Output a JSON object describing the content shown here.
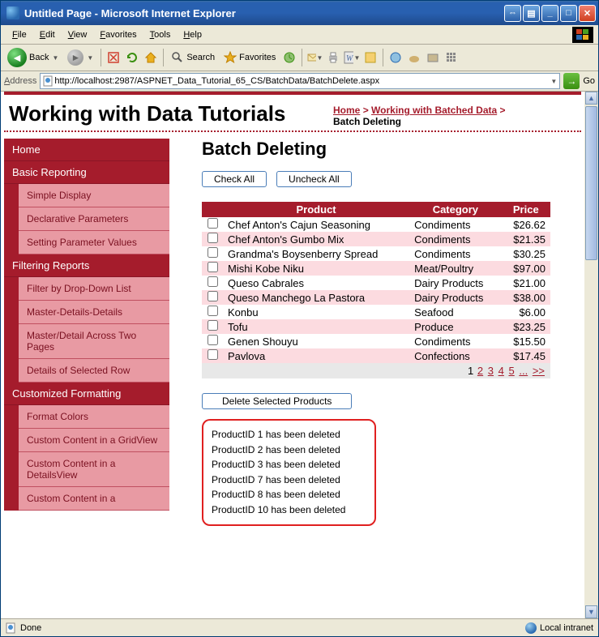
{
  "window": {
    "title": "Untitled Page - Microsoft Internet Explorer"
  },
  "menubar": [
    "File",
    "Edit",
    "View",
    "Favorites",
    "Tools",
    "Help"
  ],
  "toolbar": {
    "back": "Back",
    "search": "Search",
    "favorites": "Favorites"
  },
  "address": {
    "label": "Address",
    "url": "http://localhost:2987/ASPNET_Data_Tutorial_65_CS/BatchData/BatchDelete.aspx",
    "go": "Go"
  },
  "page_title": "Working with Data Tutorials",
  "breadcrumb": {
    "home": "Home",
    "section": "Working with Batched Data",
    "current": "Batch Deleting"
  },
  "sidebar": [
    {
      "type": "header",
      "label": "Home"
    },
    {
      "type": "header",
      "label": "Basic Reporting"
    },
    {
      "type": "sub",
      "label": "Simple Display"
    },
    {
      "type": "sub",
      "label": "Declarative Parameters"
    },
    {
      "type": "sub",
      "label": "Setting Parameter Values"
    },
    {
      "type": "header",
      "label": "Filtering Reports"
    },
    {
      "type": "sub",
      "label": "Filter by Drop-Down List"
    },
    {
      "type": "sub",
      "label": "Master-Details-Details"
    },
    {
      "type": "sub",
      "label": "Master/Detail Across Two Pages"
    },
    {
      "type": "sub",
      "label": "Details of Selected Row"
    },
    {
      "type": "header",
      "label": "Customized Formatting"
    },
    {
      "type": "sub",
      "label": "Format Colors"
    },
    {
      "type": "sub",
      "label": "Custom Content in a GridView"
    },
    {
      "type": "sub",
      "label": "Custom Content in a DetailsView"
    },
    {
      "type": "sub",
      "label": "Custom Content in a"
    }
  ],
  "main": {
    "heading": "Batch Deleting",
    "check_all": "Check All",
    "uncheck_all": "Uncheck All",
    "delete_btn": "Delete Selected Products",
    "columns": [
      "Product",
      "Category",
      "Price"
    ],
    "rows": [
      {
        "product": "Chef Anton's Cajun Seasoning",
        "category": "Condiments",
        "price": "$26.62"
      },
      {
        "product": "Chef Anton's Gumbo Mix",
        "category": "Condiments",
        "price": "$21.35"
      },
      {
        "product": "Grandma's Boysenberry Spread",
        "category": "Condiments",
        "price": "$30.25"
      },
      {
        "product": "Mishi Kobe Niku",
        "category": "Meat/Poultry",
        "price": "$97.00"
      },
      {
        "product": "Queso Cabrales",
        "category": "Dairy Products",
        "price": "$21.00"
      },
      {
        "product": "Queso Manchego La Pastora",
        "category": "Dairy Products",
        "price": "$38.00"
      },
      {
        "product": "Konbu",
        "category": "Seafood",
        "price": "$6.00"
      },
      {
        "product": "Tofu",
        "category": "Produce",
        "price": "$23.25"
      },
      {
        "product": "Genen Shouyu",
        "category": "Condiments",
        "price": "$15.50"
      },
      {
        "product": "Pavlova",
        "category": "Confections",
        "price": "$17.45"
      }
    ],
    "pager": {
      "current": "1",
      "pages": [
        "2",
        "3",
        "4",
        "5"
      ],
      "ellipsis": "...",
      "next": ">>"
    },
    "messages": [
      "ProductID 1 has been deleted",
      "ProductID 2 has been deleted",
      "ProductID 3 has been deleted",
      "ProductID 7 has been deleted",
      "ProductID 8 has been deleted",
      "ProductID 10 has been deleted"
    ]
  },
  "status": {
    "left": "Done",
    "right": "Local intranet"
  }
}
